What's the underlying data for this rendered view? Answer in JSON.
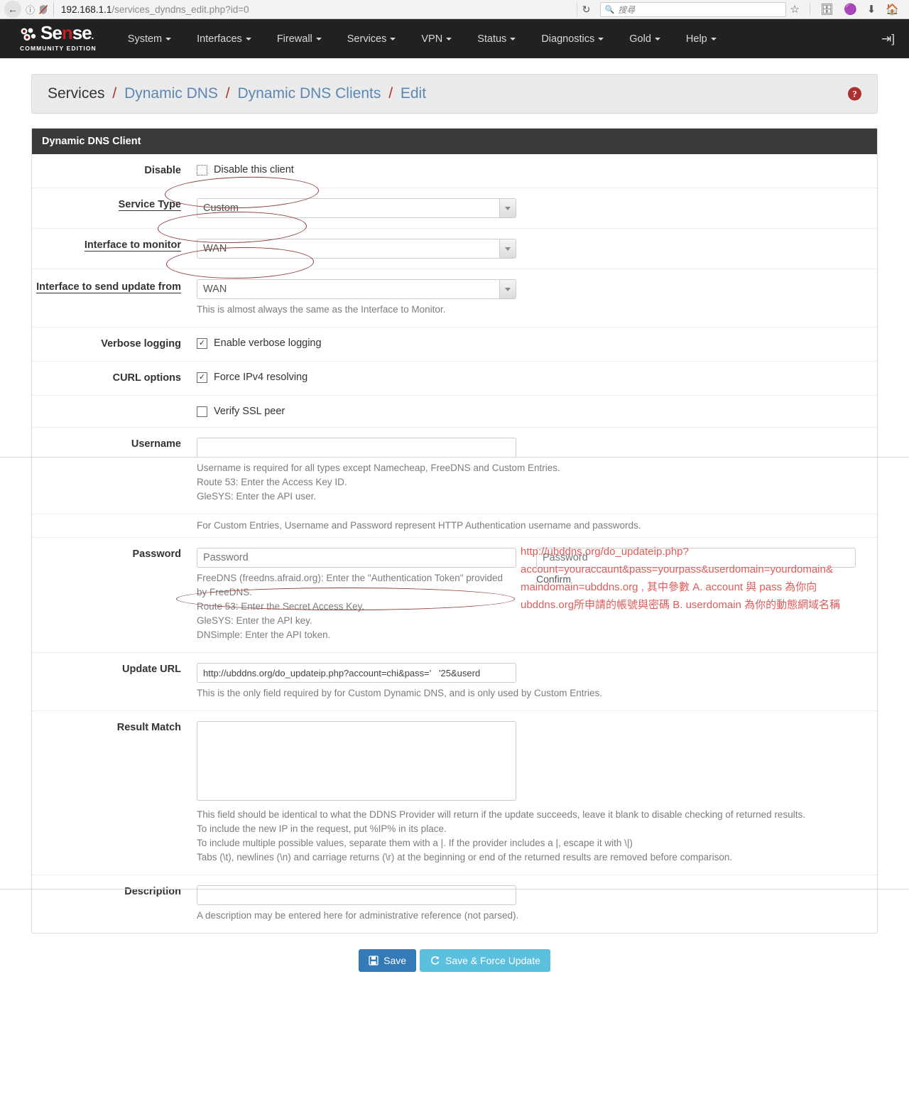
{
  "browser": {
    "back_icon": "back-arrow",
    "info_icon": "page-info",
    "security_icon": "insecure-shield",
    "url_host": "192.168.1.1",
    "url_path": "/services_dyndns_edit.php?id=0",
    "reload_icon": "reload",
    "search_placeholder": "搜尋",
    "search_icon": "magnifier",
    "icons": [
      "bookmark-star-icon",
      "library-icon",
      "pocket-icon",
      "downloads-icon",
      "home-icon"
    ]
  },
  "navbar": {
    "brand_name": "Sense",
    "brand_sub": "COMMUNITY EDITION",
    "items": [
      {
        "label": "System"
      },
      {
        "label": "Interfaces"
      },
      {
        "label": "Firewall"
      },
      {
        "label": "Services"
      },
      {
        "label": "VPN"
      },
      {
        "label": "Status"
      },
      {
        "label": "Diagnostics"
      },
      {
        "label": "Gold"
      },
      {
        "label": "Help"
      }
    ],
    "logout_icon": "logout-icon"
  },
  "breadcrumb": {
    "root": "Services",
    "level2": "Dynamic DNS",
    "level3": "Dynamic DNS Clients",
    "current": "Edit",
    "separator": "/",
    "help_badge": "?"
  },
  "panel": {
    "title": "Dynamic DNS Client"
  },
  "form": {
    "disable": {
      "label": "Disable",
      "checkbox_label": "Disable this client",
      "checked": false
    },
    "service_type": {
      "label": "Service Type",
      "value": "Custom"
    },
    "interface_monitor": {
      "label": "Interface to monitor",
      "value": "WAN"
    },
    "interface_send_update": {
      "label": "Interface to send update from",
      "value": "WAN",
      "help": "This is almost always the same as the Interface to Monitor."
    },
    "verbose_logging": {
      "label": "Verbose logging",
      "checkbox_label": "Enable verbose logging",
      "checked": true
    },
    "curl_options": {
      "label": "CURL options",
      "checkbox_label": "Force IPv4 resolving",
      "checked": true
    },
    "verify_ssl": {
      "checkbox_label": "Verify SSL peer",
      "checked": false
    },
    "username": {
      "label": "Username",
      "value": "",
      "help": [
        "Username is required for all types except Namecheap, FreeDNS and Custom Entries.",
        "Route 53: Enter the Access Key ID.",
        "GleSYS: Enter the API user.",
        "For Custom Entries, Username and Password represent HTTP Authentication username and passwords."
      ]
    },
    "password": {
      "label": "Password",
      "placeholder": "Password",
      "value": "",
      "confirm_placeholder": "Password",
      "confirm_value": "",
      "confirm_label": "Confirm",
      "help": [
        "FreeDNS (freedns.afraid.org): Enter the \"Authentication Token\" provided",
        "by FreeDNS.",
        "Route 53: Enter the Secret Access Key.",
        "GleSYS: Enter the API key.",
        "DNSimple: Enter the API token."
      ]
    },
    "update_url": {
      "label": "Update URL",
      "value": "http://ubddns.org/do_updateip.php?account=chi&pass='   '25&userd",
      "help": "This is the only field required by for Custom Dynamic DNS, and is only used by Custom Entries."
    },
    "result_match": {
      "label": "Result Match",
      "value": "",
      "help": [
        "This field should be identical to what the DDNS Provider will return if the update succeeds, leave it blank to disable checking of returned results.",
        "To include the new IP in the request, put %IP% in its place.",
        "To include multiple possible values, separate them with a |. If the provider includes a |, escape it with \\|)",
        "Tabs (\\t), newlines (\\n) and carriage returns (\\r) at the beginning or end of the returned results are removed before comparison."
      ]
    },
    "description": {
      "label": "Description",
      "value": "",
      "help": "A description may be entered here for administrative reference (not parsed)."
    }
  },
  "buttons": {
    "save": {
      "label": "Save",
      "icon": "floppy-disk-icon",
      "color": "#337ab7"
    },
    "save_force": {
      "label": "Save & Force Update",
      "icon": "refresh-icon",
      "color": "#5bc0de"
    }
  },
  "annotations": {
    "color": "#e05a5a",
    "note_lines": [
      "http://ubddns.org/do_updateip.php?",
      "account=youraccaunt&pass=yourpass&userdomain=yourdomain&",
      "maindomain=ubddns.org , 其中參數 A. account 與 pass 為你向",
      "ubddns.org所申請的帳號與密碼 B. userdomain 為你的動態網域名稱"
    ],
    "circled_fields": [
      "service-type",
      "interface-to-monitor",
      "interface-to-send-update-from",
      "update-url"
    ]
  }
}
